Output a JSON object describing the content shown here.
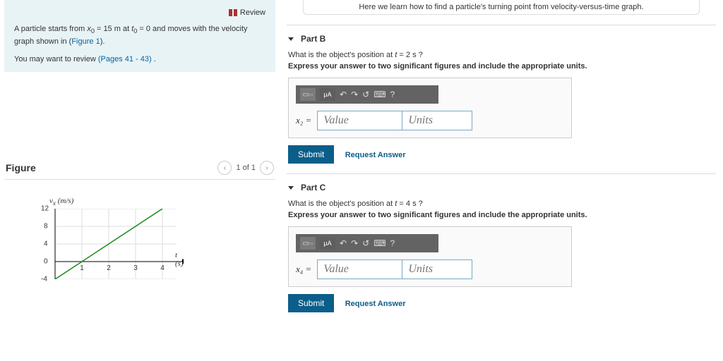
{
  "left": {
    "review": "Review",
    "intro_a": "A particle starts from ",
    "intro_b": " = 15 m at ",
    "intro_c": " = 0 and moves with the velocity graph shown in (",
    "figure_link": "Figure 1",
    "intro_d": ").",
    "hint_a": "You may want to review ",
    "pages_link": "(Pages 41 - 43)",
    "hint_b": " .",
    "figure_label": "Figure",
    "pager": "1 of 1",
    "chart": {
      "ylabel_html": "v<sub>x</sub> (m/s)",
      "xlabel_html": "t (s)",
      "yticks": [
        "12",
        "8",
        "4",
        "0",
        "-4"
      ],
      "xticks": [
        "1",
        "2",
        "3",
        "4"
      ]
    }
  },
  "right": {
    "top_note": "Here we learn how to find a particle's turning point from velocity-versus-time graph.",
    "parts": {
      "b": {
        "title": "Part B",
        "q_a": "What is the object's position at ",
        "q_b": " = 2 s ?",
        "instr": "Express your answer to two significant figures and include the appropriate units.",
        "lhs": "x₂ =",
        "value_ph": "Value",
        "units_ph": "Units",
        "submit": "Submit",
        "request": "Request Answer"
      },
      "c": {
        "title": "Part C",
        "q_a": "What is the object's position at ",
        "q_b": " = 4 s ?",
        "instr": "Express your answer to two significant figures and include the appropriate units.",
        "lhs": "x₄ =",
        "value_ph": "Value",
        "units_ph": "Units",
        "submit": "Submit",
        "request": "Request Answer"
      }
    }
  },
  "chart_data": {
    "type": "line",
    "title": "",
    "xlabel": "t (s)",
    "ylabel": "v_x (m/s)",
    "xlim": [
      0,
      4.5
    ],
    "ylim": [
      -4,
      12
    ],
    "x": [
      0,
      4
    ],
    "y": [
      -4,
      12
    ],
    "series": [
      {
        "name": "v_x",
        "x": [
          0,
          4
        ],
        "y": [
          -4,
          12
        ]
      }
    ]
  }
}
